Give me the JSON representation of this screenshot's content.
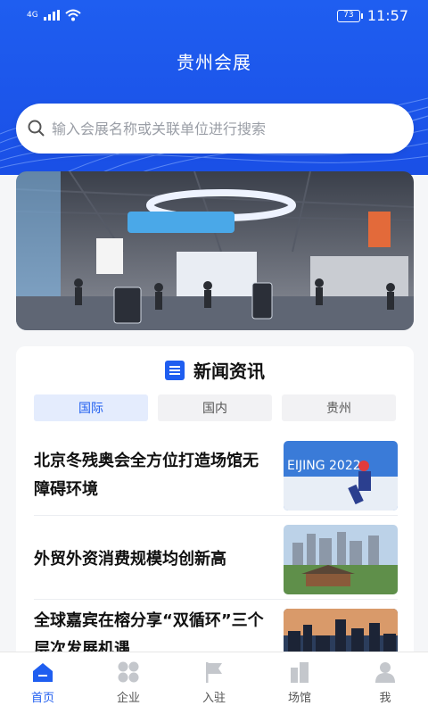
{
  "status": {
    "network": "4G",
    "battery": "73",
    "time": "11:57"
  },
  "app": {
    "title": "贵州会展"
  },
  "search": {
    "placeholder": "输入会展名称或关联单位进行搜索"
  },
  "news": {
    "section_title": "新闻资讯",
    "tabs": [
      "国际",
      "国内",
      "贵州"
    ],
    "active_tab": 0,
    "items": [
      {
        "title": "北京冬残奥会全方位打造场馆无障碍环境"
      },
      {
        "title": "外贸外资消费规模均创新高"
      },
      {
        "title": "全球嘉宾在榕分享“双循环”三个层次发展机遇"
      }
    ]
  },
  "tabbar": {
    "items": [
      {
        "label": "首页",
        "icon": "home-icon"
      },
      {
        "label": "企业",
        "icon": "enterprise-icon"
      },
      {
        "label": "入驻",
        "icon": "flag-icon"
      },
      {
        "label": "场馆",
        "icon": "building-icon"
      },
      {
        "label": "我",
        "icon": "user-icon"
      }
    ],
    "active": 0
  },
  "colors": {
    "primary": "#1f5ef0",
    "active_tab_bg": "#e4ecfd",
    "inactive_icon": "#c4c7cc"
  }
}
